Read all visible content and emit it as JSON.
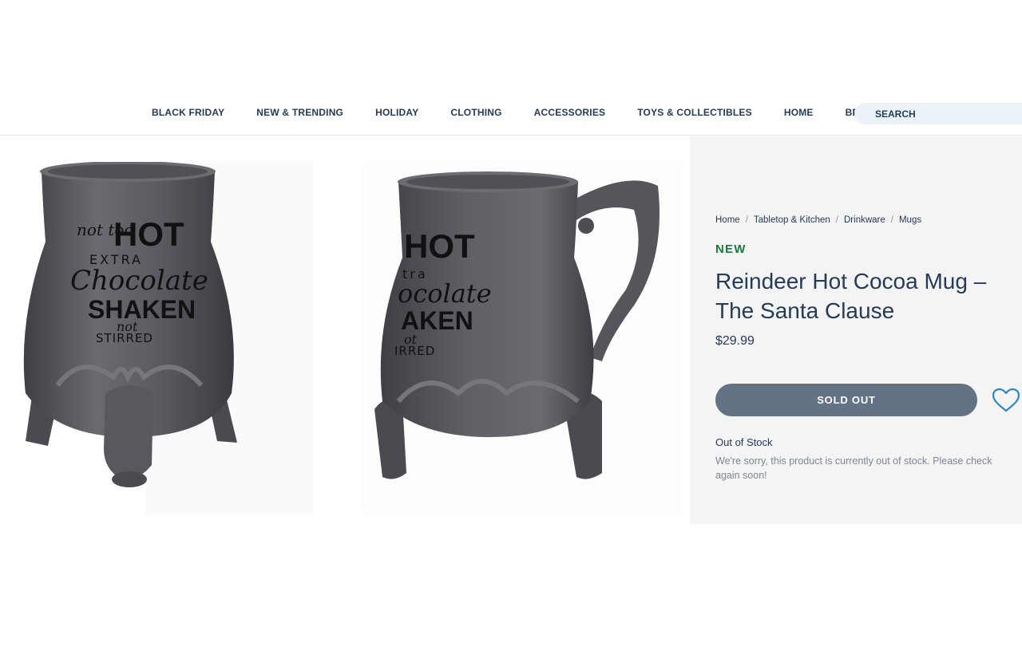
{
  "nav": {
    "items": [
      "BLACK FRIDAY",
      "NEW & TRENDING",
      "HOLIDAY",
      "CLOTHING",
      "ACCESSORIES",
      "TOYS & COLLECTIBLES",
      "HOME",
      "BRANDS"
    ],
    "search_placeholder": "SEARCH"
  },
  "gallery": {
    "image1": {
      "line1": "not too",
      "line2": "HOT",
      "line3": "EXTRA",
      "line4": "Chocolate",
      "line5": "SHAKEN",
      "line6": "not",
      "line7": "STIRRED"
    },
    "image2": {
      "line1": "HOT",
      "line2": "tra",
      "line3": "ocolate",
      "line4": "AKEN",
      "line5": "ot",
      "line6": "IRRED"
    }
  },
  "product": {
    "breadcrumb": [
      "Home",
      "Tabletop & Kitchen",
      "Drinkware",
      "Mugs"
    ],
    "badge": "NEW",
    "title": "Reindeer Hot Cocoa Mug – The Santa Clause",
    "price": "$29.99",
    "sold_out_label": "SOLD OUT",
    "stock_title": "Out of Stock",
    "stock_message": "We're sorry, this product is currently out of stock. Please check again soon!"
  },
  "colors": {
    "mug": "#5a5a60",
    "button": "#647286",
    "new_badge": "#1a7a3c",
    "heart": "#2e86c8"
  }
}
